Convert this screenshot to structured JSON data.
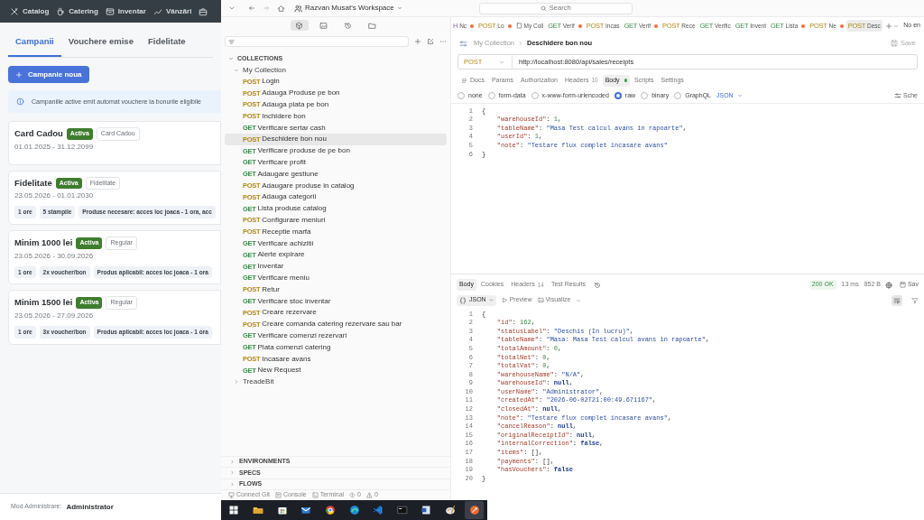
{
  "left_app": {
    "nav": [
      {
        "label": "Catalog"
      },
      {
        "label": "Catering"
      },
      {
        "label": "Inventar"
      },
      {
        "label": "Vânzări"
      }
    ],
    "tabs": [
      {
        "label": "Campanii",
        "selected": true
      },
      {
        "label": "Vouchere emise",
        "selected": false
      },
      {
        "label": "Fidelitate",
        "selected": false
      }
    ],
    "new_button": "Campanie noua",
    "info": "Campaniile active emit automat vouchere la bonurile eligibile",
    "campaigns": [
      {
        "name": "Card Cadou",
        "status": "Activa",
        "type": "Card Cadou",
        "period": "01.01.2025 - 31.12.2099"
      },
      {
        "name": "Fidelitate",
        "status": "Activa",
        "type": "Fidelitate",
        "period": "23.05.2026 - 01.01.2030",
        "chips": [
          "1 ore",
          "5 stampile",
          "Produse necesare: acces loc joaca - 1 ora, acc"
        ]
      },
      {
        "name": "Minim 1000 lei",
        "status": "Activa",
        "type": "Regular",
        "period": "23.05.2026 - 30.09.2026",
        "chips": [
          "1 ore",
          "2x voucher/bon",
          "Produs aplicabil: acces loc joaca - 1 ora"
        ]
      },
      {
        "name": "Minim 1500 lei",
        "status": "Activa",
        "type": "Regular",
        "period": "23.05.2026 - 27.09.2026",
        "chips": [
          "1 ore",
          "3x voucher/bon",
          "Produs aplicabil: acces loc joaca - 1 ora"
        ]
      }
    ],
    "footer": {
      "label": "Mod Administrare:",
      "value": "Administrator"
    }
  },
  "postman": {
    "workspace": "Razvan Musat's Workspace",
    "search": {
      "placeholder": "Search"
    },
    "sidebar": {
      "section": "COLLECTIONS",
      "collections": [
        {
          "name": "My Collection",
          "expanded": true,
          "children": [
            {
              "method": "POST",
              "kind": "post",
              "name": "Login",
              "selected": false
            },
            {
              "method": "POST",
              "kind": "post",
              "name": "Adauga Produse pe bon",
              "selected": false
            },
            {
              "method": "POST",
              "kind": "post",
              "name": "Adauga plata pe bon",
              "selected": false
            },
            {
              "method": "POST",
              "kind": "post",
              "name": "Inchidere bon",
              "selected": false
            },
            {
              "method": "GET",
              "kind": "get",
              "name": "Verificare sertar cash",
              "selected": false
            },
            {
              "method": "POST",
              "kind": "post",
              "name": "Deschidere bon nou",
              "selected": true
            },
            {
              "method": "GET",
              "kind": "get",
              "name": "Verificare produse de pe bon",
              "selected": false
            },
            {
              "method": "GET",
              "kind": "get",
              "name": "Verificare profit",
              "selected": false
            },
            {
              "method": "GET",
              "kind": "get",
              "name": "Adaugare gestiune",
              "selected": false
            },
            {
              "method": "POST",
              "kind": "post",
              "name": "Adaugare produse in catalog",
              "selected": false
            },
            {
              "method": "POST",
              "kind": "post",
              "name": "Adauga categorii",
              "selected": false
            },
            {
              "method": "GET",
              "kind": "get",
              "name": "Lista produse catalog",
              "selected": false
            },
            {
              "method": "POST",
              "kind": "post",
              "name": "Configurare meniuri",
              "selected": false
            },
            {
              "method": "POST",
              "kind": "post",
              "name": "Receptie marfa",
              "selected": false
            },
            {
              "method": "GET",
              "kind": "get",
              "name": "Verificare achizitii",
              "selected": false
            },
            {
              "method": "GET",
              "kind": "get",
              "name": "Alerte expirare",
              "selected": false
            },
            {
              "method": "GET",
              "kind": "get",
              "name": "Inventar",
              "selected": false
            },
            {
              "method": "GET",
              "kind": "get",
              "name": "Verificare meniu",
              "selected": false
            },
            {
              "method": "POST",
              "kind": "post",
              "name": "Retur",
              "selected": false
            },
            {
              "method": "GET",
              "kind": "get",
              "name": "Verificare stoc inventar",
              "selected": false
            },
            {
              "method": "POST",
              "kind": "post",
              "name": "Creare rezervare",
              "selected": false
            },
            {
              "method": "POST",
              "kind": "post",
              "name": "Creare comanda catering rezervare sau bar",
              "selected": false
            },
            {
              "method": "GET",
              "kind": "get",
              "name": "Verificare comenzi rezervari",
              "selected": false
            },
            {
              "method": "GET",
              "kind": "get",
              "name": "Plata comenzi catering",
              "selected": false
            },
            {
              "method": "POST",
              "kind": "post",
              "name": "Incasare avans",
              "selected": false
            },
            {
              "method": "GET",
              "kind": "get",
              "name": "New Request",
              "selected": false
            }
          ]
        },
        {
          "name": "TreadeBit",
          "expanded": false
        }
      ],
      "sections": [
        "ENVIRONMENTS",
        "SPECS",
        "FLOWS"
      ],
      "status_bar": [
        {
          "label": "Connect Git"
        },
        {
          "label": "Console"
        },
        {
          "label": "Terminal"
        },
        {
          "label": "0"
        },
        {
          "label": "0"
        }
      ]
    },
    "tabs": [
      {
        "kind": "other",
        "method": "H",
        "label": "Nc",
        "modified": true,
        "selected": false
      },
      {
        "kind": "post",
        "method": "POST",
        "label": "Lo",
        "modified": true,
        "selected": false
      },
      {
        "kind": "collection",
        "label": "My Coll",
        "modified": false,
        "selected": false
      },
      {
        "kind": "get",
        "method": "GET",
        "label": "Verif",
        "modified": true,
        "selected": false
      },
      {
        "kind": "post",
        "method": "POST",
        "label": "Incas",
        "modified": false,
        "selected": false
      },
      {
        "kind": "get",
        "method": "GET",
        "label": "Verif",
        "modified": true,
        "selected": false
      },
      {
        "kind": "post",
        "method": "POST",
        "label": "Rece",
        "modified": false,
        "selected": false
      },
      {
        "kind": "get",
        "method": "GET",
        "label": "Verific",
        "modified": false,
        "selected": false
      },
      {
        "kind": "get",
        "method": "GET",
        "label": "Invent",
        "modified": false,
        "selected": false
      },
      {
        "kind": "get",
        "method": "GET",
        "label": "Lista",
        "modified": true,
        "selected": false
      },
      {
        "kind": "post",
        "method": "POST",
        "label": "Ne",
        "modified": true,
        "selected": false
      },
      {
        "kind": "post",
        "method": "POST",
        "label": "Desc",
        "modified": false,
        "selected": true
      }
    ],
    "environment": "No en",
    "breadcrumb": {
      "parent": "My Collection",
      "current": "Deschidere bon nou"
    },
    "save": "Save",
    "request": {
      "method": "POST",
      "url": "http://localhost:8080/api/sales/receipts",
      "tabs": [
        {
          "label": "Docs",
          "selected": false
        },
        {
          "label": "Params",
          "selected": false
        },
        {
          "label": "Authorization",
          "selected": false
        },
        {
          "label": "Headers",
          "count": "10",
          "selected": false
        },
        {
          "label": "Body",
          "dot": true,
          "selected": true
        },
        {
          "label": "Scripts",
          "selected": false
        },
        {
          "label": "Settings",
          "selected": false
        }
      ],
      "body_modes": [
        {
          "label": "none",
          "selected": false
        },
        {
          "label": "form-data",
          "selected": false
        },
        {
          "label": "x-www-form-urlencoded",
          "selected": false
        },
        {
          "label": "raw",
          "selected": true
        },
        {
          "label": "binary",
          "selected": false
        },
        {
          "label": "GraphQL",
          "selected": false
        }
      ],
      "language": "JSON",
      "schema": "Sche",
      "lines": [
        {
          "n": "1",
          "text": "{"
        },
        {
          "n": "2",
          "text": "    \"warehouseId\": 1,"
        },
        {
          "n": "3",
          "text": "    \"tableName\": \"Masa Test calcul avans in rapoarte\","
        },
        {
          "n": "4",
          "text": "    \"userId\": 1,"
        },
        {
          "n": "5",
          "text": "    \"note\": \"Testare flux complet incasare avans\""
        },
        {
          "n": "6",
          "text": "}"
        }
      ]
    },
    "response": {
      "tabs": [
        {
          "label": "Body",
          "selected": true
        },
        {
          "label": "Cookies",
          "selected": false
        },
        {
          "label": "Headers",
          "count": "14",
          "selected": false
        },
        {
          "label": "Test Results",
          "selected": false
        }
      ],
      "status": "200 OK",
      "time": "13 ms",
      "size": "852 B",
      "save": "Sav",
      "format": "JSON",
      "preview": "Preview",
      "visualize": "Visualize",
      "wrap_on": true,
      "lines": [
        {
          "n": "1",
          "text": "{"
        },
        {
          "n": "2",
          "text": "    \"id\": 162,"
        },
        {
          "n": "3",
          "text": "    \"statusLabel\": \"Deschis (In lucru)\","
        },
        {
          "n": "4",
          "text": "    \"tableName\": \"Masa: Masa Test calcul avans in rapoarte\","
        },
        {
          "n": "5",
          "text": "    \"totalAmount\": 0,"
        },
        {
          "n": "6",
          "text": "    \"totalNet\": 0,"
        },
        {
          "n": "7",
          "text": "    \"totalVat\": 0,"
        },
        {
          "n": "8",
          "text": "    \"warehouseName\": \"N/A\","
        },
        {
          "n": "9",
          "text": "    \"warehouseId\": null,"
        },
        {
          "n": "10",
          "text": "    \"userName\": \"Administrator\","
        },
        {
          "n": "11",
          "text": "    \"createdAt\": \"2026-06-02T21:00:49.671167\","
        },
        {
          "n": "12",
          "text": "    \"closedAt\": null,"
        },
        {
          "n": "13",
          "text": "    \"note\": \"Testare flux complet incasare avans\","
        },
        {
          "n": "14",
          "text": "    \"cancelReason\": null,"
        },
        {
          "n": "15",
          "text": "    \"originalReceiptId\": null,"
        },
        {
          "n": "16",
          "text": "    \"internalCorrection\": false,"
        },
        {
          "n": "17",
          "text": "    \"items\": [],"
        },
        {
          "n": "18",
          "text": "    \"payments\": [],"
        },
        {
          "n": "19",
          "text": "    \"hasVouchers\": false"
        },
        {
          "n": "20",
          "text": "}"
        }
      ]
    }
  },
  "taskbar": {
    "apps": [
      {
        "selected": false
      },
      {
        "selected": false
      },
      {
        "selected": false
      },
      {
        "selected": false
      },
      {
        "selected": false
      },
      {
        "selected": false
      },
      {
        "selected": false
      },
      {
        "selected": false
      },
      {
        "selected": false
      },
      {
        "selected": false
      },
      {
        "selected": true
      }
    ]
  }
}
